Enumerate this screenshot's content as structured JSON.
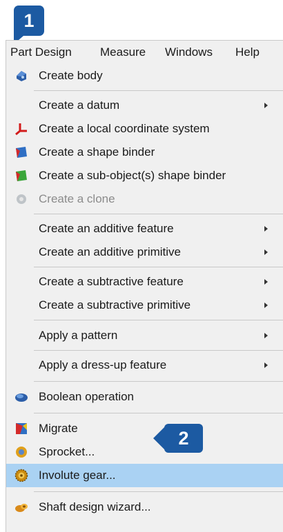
{
  "steps": {
    "step1": "1",
    "step2": "2"
  },
  "menubar": {
    "items": [
      "Part Design",
      "Measure",
      "Windows",
      "Help"
    ]
  },
  "menu": {
    "create_body": "Create body",
    "create_datum": "Create a datum",
    "create_lcs": "Create a local coordinate system",
    "create_shape_binder": "Create a shape binder",
    "create_subobject_binder": "Create a sub-object(s) shape binder",
    "create_clone": "Create a clone",
    "create_additive_feature": "Create an additive feature",
    "create_additive_primitive": "Create an additive primitive",
    "create_subtractive_feature": "Create a subtractive feature",
    "create_subtractive_primitive": "Create a subtractive primitive",
    "apply_pattern": "Apply a pattern",
    "apply_dressup": "Apply a dress-up feature",
    "boolean_operation": "Boolean operation",
    "migrate": "Migrate",
    "sprocket": "Sprocket...",
    "involute_gear": "Involute gear...",
    "shaft_wizard": "Shaft design wizard..."
  },
  "colors": {
    "highlight": "#aad2f3",
    "badge": "#1c5aa2",
    "panel": "#f0f0f0"
  },
  "icons": {
    "create_body": "body-icon",
    "create_lcs": "coordinate-system-icon",
    "create_shape_binder": "shape-binder-icon",
    "create_subobject_binder": "subobject-binder-icon",
    "create_clone": "clone-icon",
    "boolean_operation": "boolean-icon",
    "migrate": "migrate-icon",
    "sprocket": "sprocket-icon",
    "involute_gear": "gear-icon",
    "shaft_wizard": "shaft-wizard-icon"
  }
}
